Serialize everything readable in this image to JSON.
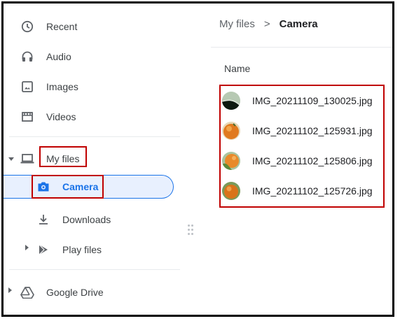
{
  "sidebar": {
    "items": [
      {
        "label": "Recent",
        "icon": "clock-icon"
      },
      {
        "label": "Audio",
        "icon": "headphones-icon"
      },
      {
        "label": "Images",
        "icon": "image-icon"
      },
      {
        "label": "Videos",
        "icon": "film-icon"
      }
    ],
    "my_files": {
      "label": "My files",
      "icon": "laptop-icon"
    },
    "sub_items": [
      {
        "label": "Camera",
        "icon": "camera-icon"
      },
      {
        "label": "Downloads",
        "icon": "download-icon"
      },
      {
        "label": "Play files",
        "icon": "play-store-icon"
      }
    ],
    "drive": {
      "label": "Google Drive",
      "icon": "drive-icon"
    }
  },
  "breadcrumb": {
    "root": "My files",
    "separator": ">",
    "current": "Camera"
  },
  "columns": {
    "name": "Name"
  },
  "files": [
    {
      "name": "IMG_20211109_130025.jpg"
    },
    {
      "name": "IMG_20211102_125931.jpg"
    },
    {
      "name": "IMG_20211102_125806.jpg"
    },
    {
      "name": "IMG_20211102_125726.jpg"
    }
  ],
  "colors": {
    "accent": "#1a73e8",
    "selected_bg": "#e8f0fe",
    "highlight_box": "#c00000"
  }
}
